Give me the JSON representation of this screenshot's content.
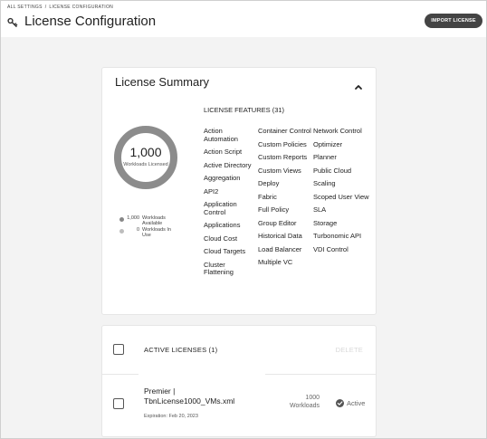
{
  "breadcrumb": {
    "root": "ALL SETTINGS",
    "separator": "/",
    "current": "LICENSE CONFIGURATION"
  },
  "header": {
    "title": "License Configuration",
    "import_button_label": "IMPORT LICENSE",
    "icon": "key-icon"
  },
  "summary": {
    "title": "License Summary",
    "collapse_icon": "chevron-up-icon",
    "donut": {
      "value": "1,000",
      "label": "Workloads Licensed",
      "used_fraction": 0
    },
    "legend": [
      {
        "count": "1,000",
        "label": "Workloads Available",
        "color": "#888888"
      },
      {
        "count": "0",
        "label": "Workloads In Use",
        "color": "#bdbdbd"
      }
    ],
    "features_heading": "LICENSE FEATURES (31)",
    "features": [
      [
        "Action Automation",
        "Action Script",
        "Active Directory",
        "Aggregation",
        "API2",
        "Application Control",
        "Applications",
        "Cloud Cost",
        "Cloud Targets",
        "Cluster Flattening"
      ],
      [
        "Container Control",
        "Custom Policies",
        "Custom Reports",
        "Custom Views",
        "Deploy",
        "Fabric",
        "Full Policy",
        "Group Editor",
        "Historical Data",
        "Load Balancer",
        "Multiple VC"
      ],
      [
        "Network Control",
        "Optimizer",
        "Planner",
        "Public Cloud",
        "Scaling",
        "Scoped User View",
        "SLA",
        "Storage",
        "Turbonomic API",
        "VDI Control"
      ]
    ]
  },
  "active_licenses": {
    "title": "ACTIVE LICENSES (1)",
    "delete_label": "DELETE",
    "rows": [
      {
        "name_line1": "Premier |",
        "name_line2": "TbnLicense1000_VMs.xml",
        "expiration": "Expiration: Feb 20, 2023",
        "workloads_count": "1000",
        "workloads_label": "Workloads",
        "status": "Active"
      }
    ]
  },
  "colors": {
    "donut_ring": "#8c8c8c",
    "button_bg": "#444444",
    "background": "#f3f3f3"
  }
}
